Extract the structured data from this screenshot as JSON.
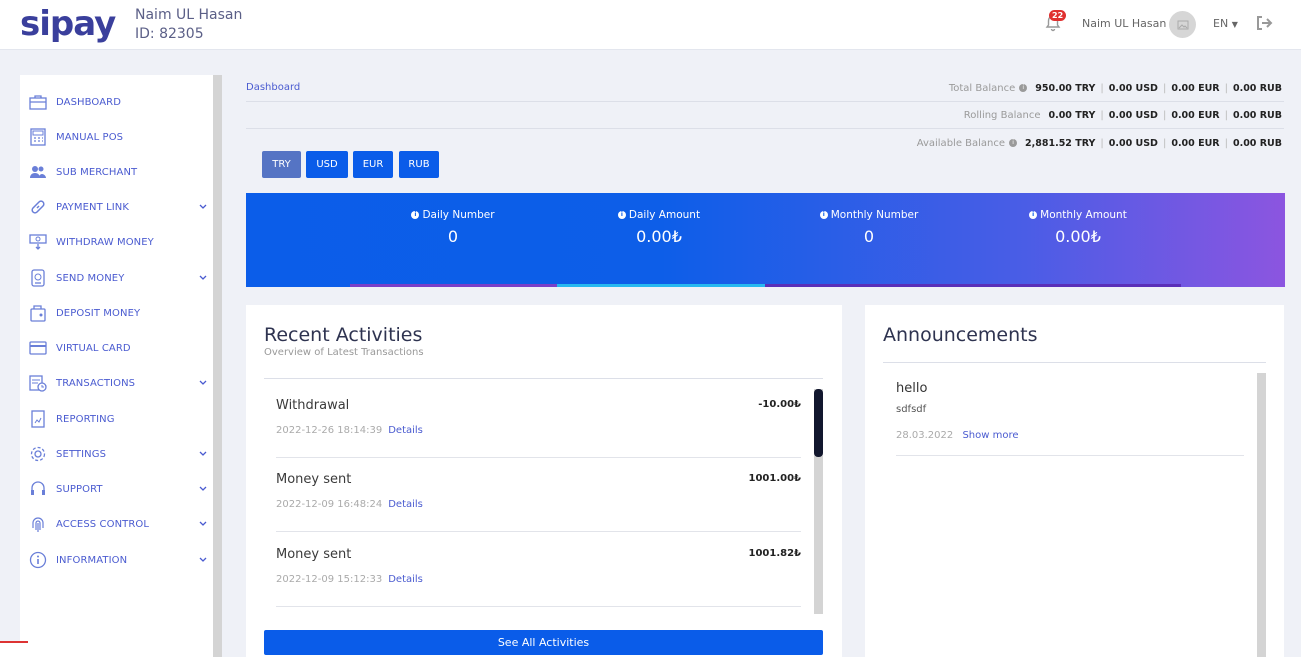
{
  "header": {
    "logo": "sipay",
    "user_name": "Naim UL Hasan",
    "user_id": "ID: 82305",
    "notification_count": "22",
    "account_name": "Naim UL Hasan",
    "language": "EN"
  },
  "sidebar": {
    "items": [
      {
        "label": "DASHBOARD",
        "icon": "briefcase-icon",
        "has_submenu": false
      },
      {
        "label": "MANUAL POS",
        "icon": "calculator-icon",
        "has_submenu": false
      },
      {
        "label": "SUB MERCHANT",
        "icon": "users-icon",
        "has_submenu": false
      },
      {
        "label": "PAYMENT LINK",
        "icon": "link-icon",
        "has_submenu": true
      },
      {
        "label": "WITHDRAW MONEY",
        "icon": "withdraw-icon",
        "has_submenu": false
      },
      {
        "label": "SEND MONEY",
        "icon": "send-money-icon",
        "has_submenu": true
      },
      {
        "label": "DEPOSIT MONEY",
        "icon": "wallet-icon",
        "has_submenu": false
      },
      {
        "label": "VIRTUAL CARD",
        "icon": "credit-card-icon",
        "has_submenu": false
      },
      {
        "label": "TRANSACTIONS",
        "icon": "transactions-icon",
        "has_submenu": true
      },
      {
        "label": "REPORTING",
        "icon": "report-icon",
        "has_submenu": false
      },
      {
        "label": "SETTINGS",
        "icon": "gear-icon",
        "has_submenu": true
      },
      {
        "label": "SUPPORT",
        "icon": "headset-icon",
        "has_submenu": true
      },
      {
        "label": "ACCESS CONTROL",
        "icon": "fingerprint-icon",
        "has_submenu": true
      },
      {
        "label": "INFORMATION",
        "icon": "info-icon",
        "has_submenu": true
      }
    ]
  },
  "breadcrumb": "Dashboard",
  "balances": {
    "total": {
      "label": "Total Balance",
      "try": "950.00 TRY",
      "usd": "0.00 USD",
      "eur": "0.00 EUR",
      "rub": "0.00 RUB"
    },
    "rolling": {
      "label": "Rolling Balance",
      "try": "0.00 TRY",
      "usd": "0.00 USD",
      "eur": "0.00 EUR",
      "rub": "0.00 RUB"
    },
    "available": {
      "label": "Available Balance",
      "try": "2,881.52 TRY",
      "usd": "0.00 USD",
      "eur": "0.00 EUR",
      "rub": "0.00 RUB"
    }
  },
  "currencies": [
    "TRY",
    "USD",
    "EUR",
    "RUB"
  ],
  "selected_currency": "TRY",
  "stats": {
    "daily_number": {
      "label": "Daily Number",
      "value": "0"
    },
    "daily_amount": {
      "label": "Daily Amount",
      "value": "0.00₺"
    },
    "monthly_number": {
      "label": "Monthly Number",
      "value": "0"
    },
    "monthly_amount": {
      "label": "Monthly Amount",
      "value": "0.00₺"
    }
  },
  "recent_activities": {
    "title": "Recent Activities",
    "subtitle": "Overview of Latest Transactions",
    "items": [
      {
        "title": "Withdrawal",
        "date": "2022-12-26 18:14:39",
        "link": "Details",
        "amount": "-10.00₺"
      },
      {
        "title": "Money sent",
        "date": "2022-12-09 16:48:24",
        "link": "Details",
        "amount": "1001.00₺"
      },
      {
        "title": "Money sent",
        "date": "2022-12-09 15:12:33",
        "link": "Details",
        "amount": "1001.82₺"
      }
    ],
    "see_all": "See All Activities"
  },
  "announcements": {
    "title": "Announcements",
    "items": [
      {
        "title": "hello",
        "body": "sdfsdf",
        "date": "28.03.2022",
        "link": "Show more"
      }
    ]
  },
  "colors": {
    "accent": "#0a5ce9",
    "brand": "#3a3f9c",
    "sidebar_text": "#4a5bd0"
  }
}
